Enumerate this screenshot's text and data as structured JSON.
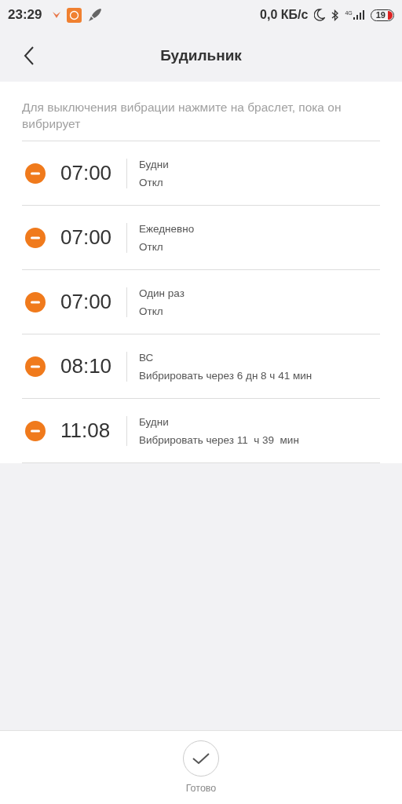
{
  "status_bar": {
    "time": "23:29",
    "speed": "0,0 КБ/с",
    "network": "4G",
    "battery": "19"
  },
  "header": {
    "title": "Будильник"
  },
  "hint": "Для выключения вибрации нажмите на браслет, пока он вибрирует",
  "alarms": [
    {
      "time": "07:00",
      "repeat": "Будни",
      "status": "Откл"
    },
    {
      "time": "07:00",
      "repeat": "Ежедневно",
      "status": "Откл"
    },
    {
      "time": "07:00",
      "repeat": "Один раз",
      "status": "Откл"
    },
    {
      "time": "08:10",
      "repeat": "ВС",
      "status": "Вибрировать через 6 дн 8 ч 41 мин"
    },
    {
      "time": "11:08",
      "repeat": "Будни",
      "status": "Вибрировать через 11  ч 39  мин"
    }
  ],
  "done_button": {
    "label": "Готово"
  }
}
